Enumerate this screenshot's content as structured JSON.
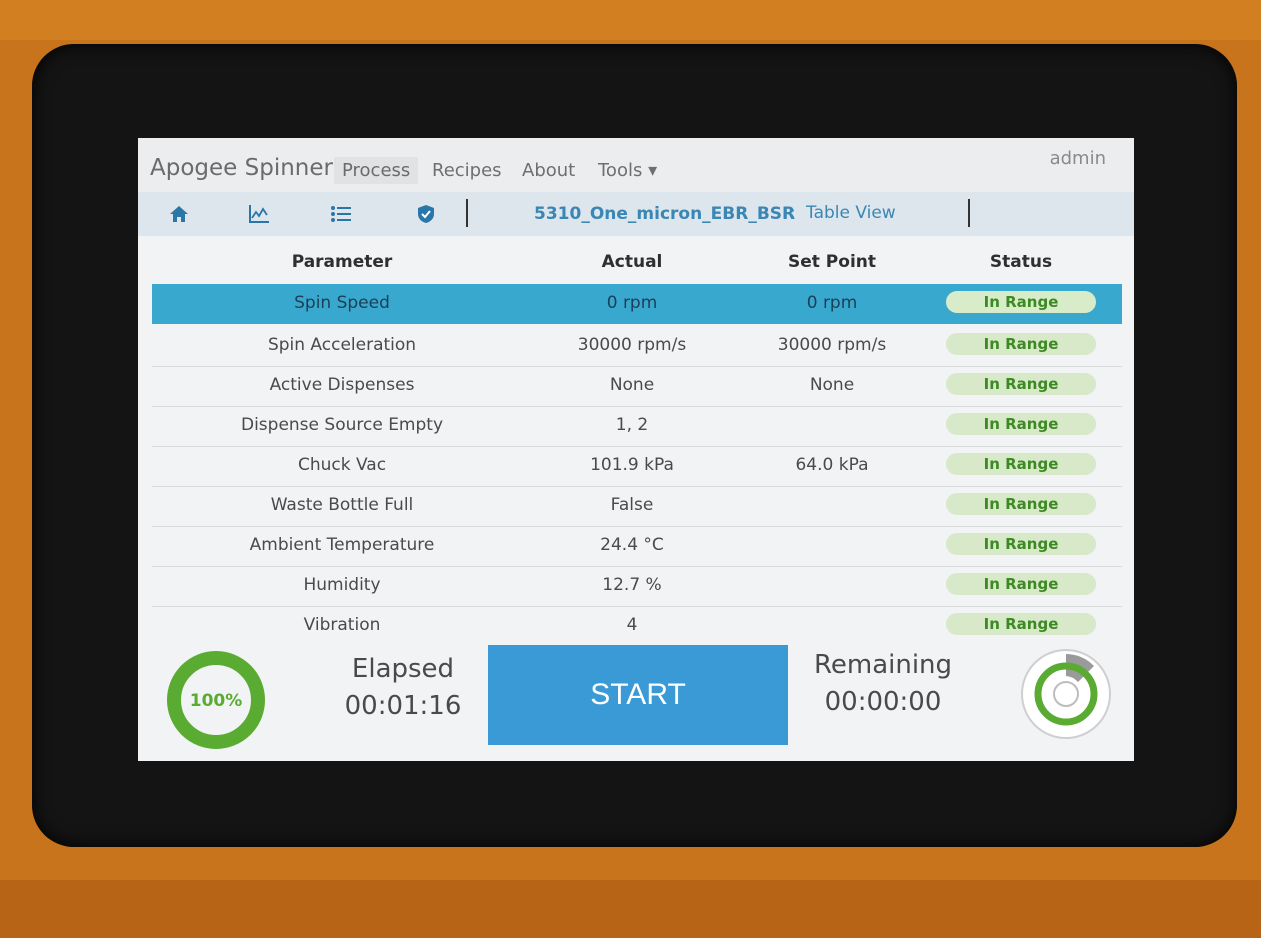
{
  "app": {
    "title": "Apogee Spinner",
    "user": "admin"
  },
  "menu": [
    {
      "label": "Process",
      "active": true
    },
    {
      "label": "Recipes",
      "active": false
    },
    {
      "label": "About",
      "active": false
    },
    {
      "label": "Tools ▾",
      "active": false
    }
  ],
  "toolbar": {
    "icons": [
      "home-icon",
      "chart-icon",
      "list-icon",
      "shield-icon"
    ],
    "recipe_name": "5310_One_micron_EBR_BSR",
    "separator": ":",
    "view_name": "Table View"
  },
  "table": {
    "headers": {
      "parameter": "Parameter",
      "actual": "Actual",
      "set_point": "Set Point",
      "status": "Status"
    },
    "rows": [
      {
        "parameter": "Spin Speed",
        "actual": "0 rpm",
        "set_point": "0 rpm",
        "status": "In Range"
      },
      {
        "parameter": "Spin Acceleration",
        "actual": "30000 rpm/s",
        "set_point": "30000 rpm/s",
        "status": "In Range"
      },
      {
        "parameter": "Active Dispenses",
        "actual": "None",
        "set_point": "None",
        "status": "In Range"
      },
      {
        "parameter": "Dispense Source Empty",
        "actual": "1, 2",
        "set_point": "",
        "status": "In Range"
      },
      {
        "parameter": "Chuck Vac",
        "actual": "101.9 kPa",
        "set_point": "64.0 kPa",
        "status": "In Range"
      },
      {
        "parameter": "Waste Bottle Full",
        "actual": "False",
        "set_point": "",
        "status": "In Range"
      },
      {
        "parameter": "Ambient Temperature",
        "actual": "24.4 °C",
        "set_point": "",
        "status": "In Range"
      },
      {
        "parameter": "Humidity",
        "actual": "12.7 %",
        "set_point": "",
        "status": "In Range"
      },
      {
        "parameter": "Vibration",
        "actual": "4",
        "set_point": "",
        "status": "In Range"
      }
    ]
  },
  "footer": {
    "progress": {
      "label": "100%",
      "value": 1.0
    },
    "elapsed_label": "Elapsed",
    "elapsed_time": "00:01:16",
    "start_label": "START",
    "remaining_label": "Remaining",
    "remaining_time": "00:00:00"
  },
  "colors": {
    "accent": "#39a8cf",
    "button": "#3a9ad6",
    "status_ok_bg": "#d7e9c8",
    "status_ok_text": "#3c8a23",
    "progress_green": "#5aab32"
  }
}
